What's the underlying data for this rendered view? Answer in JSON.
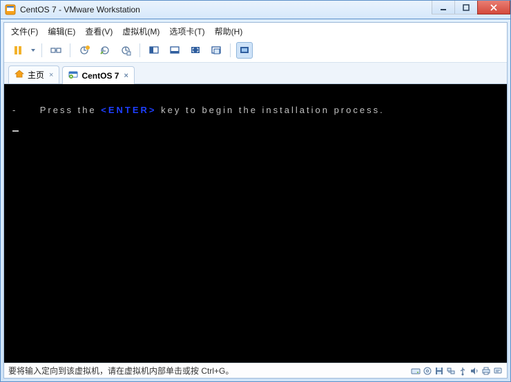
{
  "window": {
    "title": "CentOS 7 - VMware Workstation"
  },
  "menu": {
    "file": "文件(F)",
    "edit": "编辑(E)",
    "view": "查看(V)",
    "vm": "虚拟机(M)",
    "tabs": "选项卡(T)",
    "help": "帮助(H)"
  },
  "tabs": {
    "home": "主页",
    "vm": "CentOS 7"
  },
  "terminal": {
    "dash": "-",
    "pre": "Press the ",
    "enter": "<ENTER>",
    "post": " key to begin the installation process."
  },
  "status": {
    "msg": "要将输入定向到该虚拟机，请在虚拟机内部单击或按 Ctrl+G。"
  }
}
